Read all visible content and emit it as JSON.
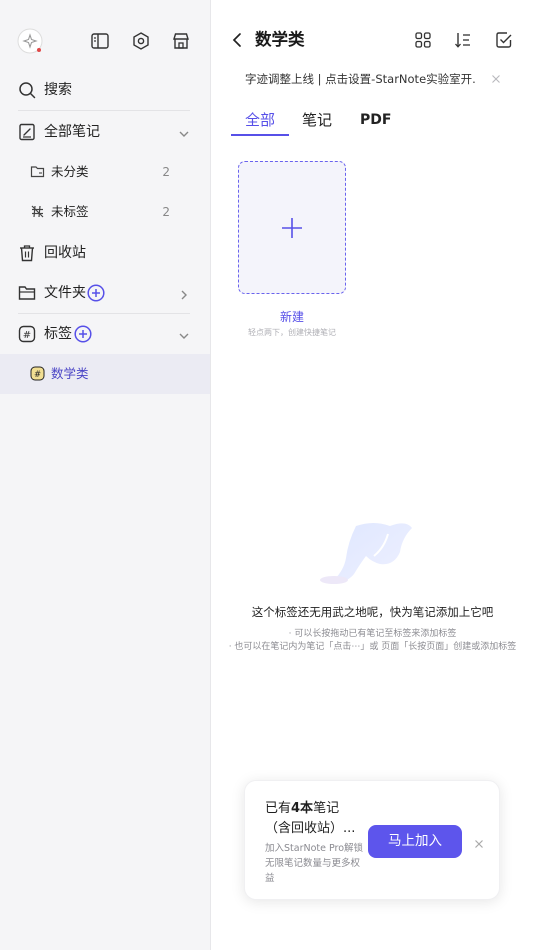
{
  "sidebar": {
    "items": [
      {
        "label": "搜索",
        "icon": "search-icon"
      },
      {
        "label": "全部笔记",
        "icon": "notebook-icon"
      },
      {
        "label": "未分类",
        "count": "2",
        "icon": "folder-unsorted-icon"
      },
      {
        "label": "未标签",
        "count": "2",
        "icon": "untagged-icon"
      },
      {
        "label": "回收站",
        "icon": "trash-icon"
      },
      {
        "label": "文件夹",
        "icon": "folder-icon"
      },
      {
        "label": "标签",
        "icon": "hashtag-icon"
      },
      {
        "label": "数学类",
        "icon": "tag-icon"
      }
    ],
    "accent": "#5750e8"
  },
  "header": {
    "title": "数学类"
  },
  "notice": {
    "text": "字迹调整上线 | 点击设置-StarNote实验室开..."
  },
  "tabs": [
    {
      "label": "全部"
    },
    {
      "label": "笔记"
    },
    {
      "label": "PDF"
    }
  ],
  "new_card": {
    "label": "新建",
    "hint": "轻点两下，创建快捷笔记"
  },
  "empty": {
    "title": "这个标签还无用武之地呢，快为笔记添加上它吧",
    "line1": "· 可以长按拖动已有笔记至标签来添加标签",
    "line2": "· 也可以在笔记内为笔记「点击⋯」或 页面「长按页面」创建或添加标签"
  },
  "promo": {
    "title_prefix": "已有",
    "title_bold": "4本",
    "title_suffix": "笔记（含回收站）...",
    "desc": "加入StarNote Pro解锁无限笔记数量与更多权益",
    "button": "马上加入"
  }
}
